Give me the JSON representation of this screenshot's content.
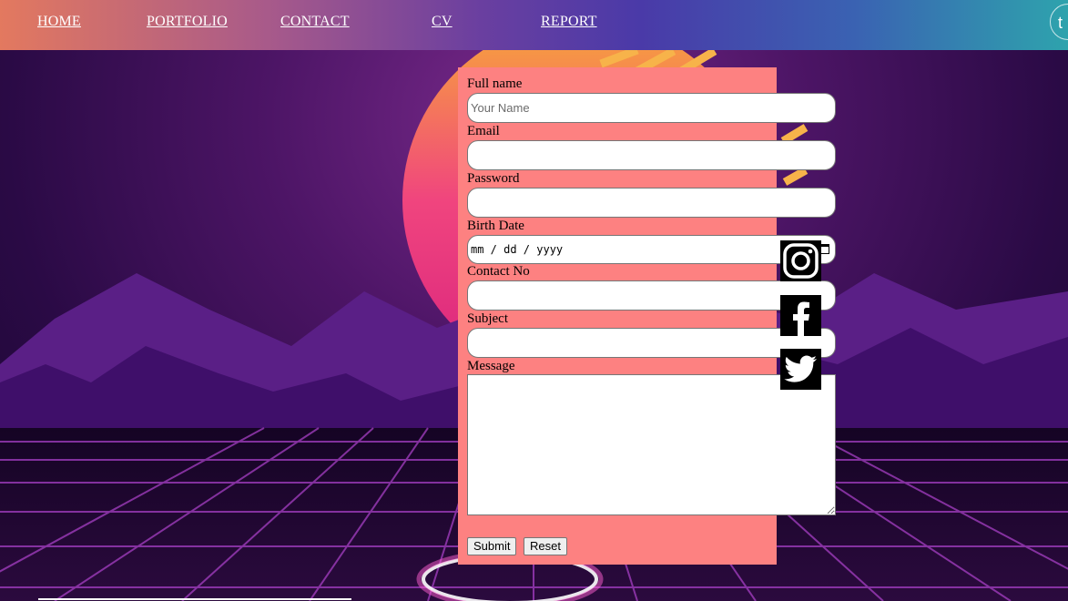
{
  "nav": {
    "items": [
      {
        "label": "HOME"
      },
      {
        "label": "PORTFOLIO"
      },
      {
        "label": "CONTACT"
      },
      {
        "label": "CV"
      },
      {
        "label": "REPORT"
      }
    ],
    "round_button_label": "t"
  },
  "form": {
    "full_name_label": "Full name",
    "full_name_placeholder": "Your Name",
    "email_label": "Email",
    "password_label": "Password",
    "birth_date_label": "Birth Date",
    "birth_date_placeholder": "mm / dd / yyyy",
    "contact_label": "Contact No",
    "subject_label": "Subject",
    "message_label": "Message",
    "submit_label": "Submit",
    "reset_label": "Reset"
  },
  "social": {
    "icons": [
      "instagram-icon",
      "facebook-icon",
      "twitter-icon"
    ]
  },
  "colors": {
    "form_background": "#fd8181",
    "nav_gradient_start": "#e3795f",
    "nav_gradient_end": "#2ea3ad"
  }
}
